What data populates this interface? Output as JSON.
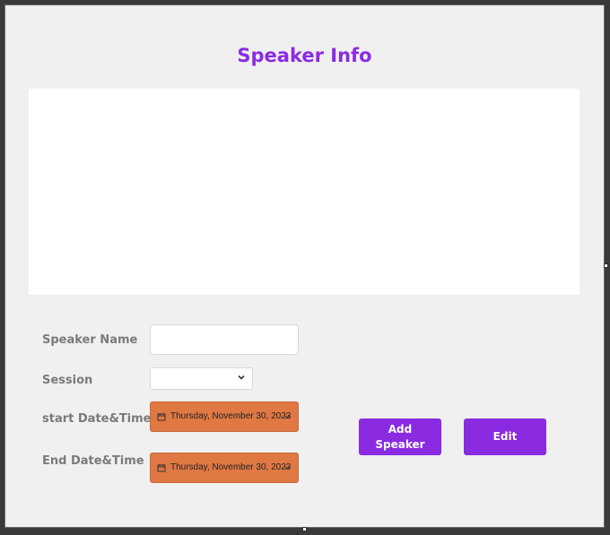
{
  "screen": {
    "title": "Speaker Info"
  },
  "form": {
    "speaker_name_label": "Speaker Name",
    "speaker_name_value": "",
    "session_label": "Session",
    "session_value": "",
    "start_label": "start Date&Time",
    "start_value": "Thursday, November 30, 2023",
    "end_label": "End Date&Time",
    "end_value": "Thursday, November 30, 2023"
  },
  "buttons": {
    "add_speaker": "Add Speaker",
    "edit": "Edit"
  },
  "colors": {
    "accent": "#8a2be2",
    "date_picker": "#e07844",
    "canvas": "#f0f0f0"
  },
  "icons": {
    "dropdown": "chevron-down-icon",
    "calendar": "calendar-icon"
  }
}
